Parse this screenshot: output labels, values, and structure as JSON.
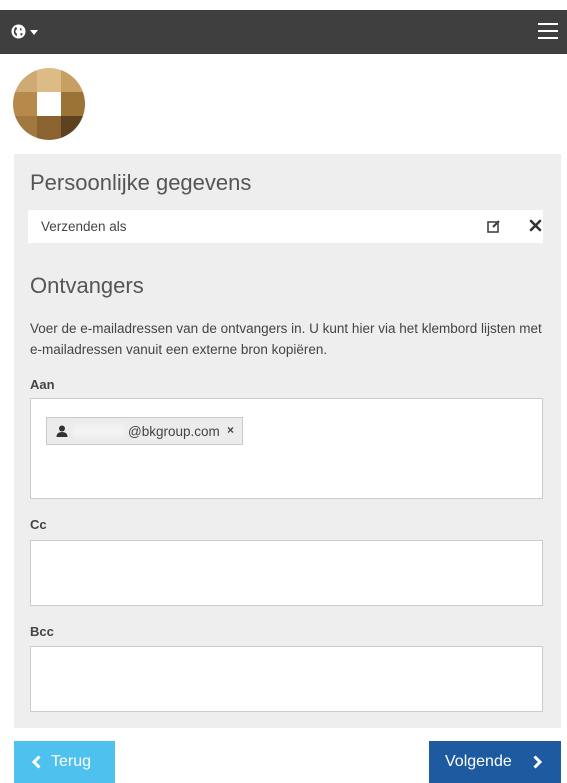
{
  "header": {
    "globe_icon": "globe-icon",
    "menu_icon": "hamburger-menu-icon"
  },
  "personal": {
    "title": "Persoonlijke gegevens",
    "send_as_label": "Verzenden als"
  },
  "recipients": {
    "title": "Ontvangers",
    "description": "Voer de e-mailadressen van de ontvangers in. U kunt hier via het klembord lijsten met e-mailadressen vanuit een externe bron kopiëren.",
    "to": {
      "label": "Aan",
      "chips": [
        {
          "address": "@bkgroup.com",
          "remove": "×"
        }
      ]
    },
    "cc": {
      "label": "Cc"
    },
    "bcc": {
      "label": "Bcc"
    }
  },
  "footer": {
    "back_label": "Terug",
    "next_label": "Volgende"
  },
  "colors": {
    "topbar": "#3f3f3f",
    "panel": "#eeeeee",
    "back_button": "#4fc1ef",
    "next_button": "#1e5aa0"
  }
}
